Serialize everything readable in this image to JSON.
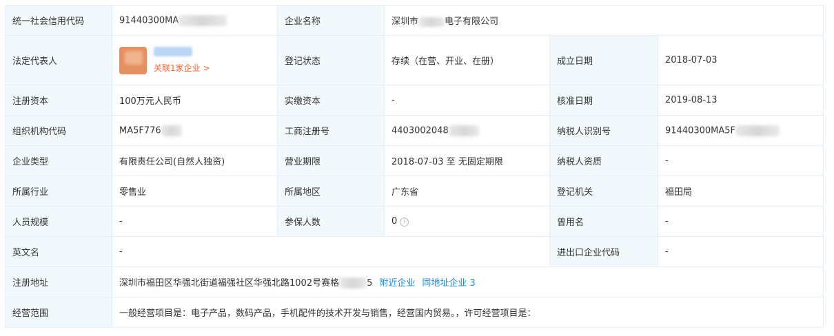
{
  "fields": {
    "credit_code": {
      "label": "统一社会信用代码",
      "value": "91440300MA"
    },
    "company_name": {
      "label": "企业名称",
      "value_pre": "深圳市",
      "value_post": "电子有限公司"
    },
    "legal_rep": {
      "label": "法定代表人",
      "related_link": "关联1家企业 >"
    },
    "reg_status": {
      "label": "登记状态",
      "value": "存续（在营、开业、在册）"
    },
    "found_date": {
      "label": "成立日期",
      "value": "2018-07-03"
    },
    "reg_capital": {
      "label": "注册资本",
      "value": "100万元人民币"
    },
    "paid_capital": {
      "label": "实缴资本",
      "value": "-"
    },
    "approve_date": {
      "label": "核准日期",
      "value": "2019-08-13"
    },
    "org_code": {
      "label": "组织机构代码",
      "value": "MA5F776"
    },
    "biz_reg_no": {
      "label": "工商注册号",
      "value": "4403002048"
    },
    "taxpayer_id": {
      "label": "纳税人识别号",
      "value": "91440300MA5F"
    },
    "company_type": {
      "label": "企业类型",
      "value": "有限责任公司(自然人独资)"
    },
    "biz_term": {
      "label": "营业期限",
      "value": "2018-07-03 至 无固定期限"
    },
    "tax_quality": {
      "label": "纳税人资质",
      "value": "-"
    },
    "industry": {
      "label": "所属行业",
      "value": "零售业"
    },
    "region": {
      "label": "所属地区",
      "value": "广东省"
    },
    "reg_authority": {
      "label": "登记机关",
      "value": "福田局"
    },
    "staff_size": {
      "label": "人员规模",
      "value": "-"
    },
    "insured_count": {
      "label": "参保人数",
      "value": "0"
    },
    "former_name": {
      "label": "曾用名",
      "value": "-"
    },
    "english_name": {
      "label": "英文名",
      "value": "-"
    },
    "ie_code": {
      "label": "进出口企业代码",
      "value": "-"
    },
    "reg_address": {
      "label": "注册地址",
      "value_pre": "深圳市福田区华强北街道福强社区华强北路1002号赛格",
      "value_post": "5",
      "nearby_link": "附近企业",
      "same_address_link": "同地址企业 3"
    },
    "biz_scope": {
      "label": "经营范围",
      "value": "一般经营项目是：电子产品，数码产品，手机配件的技术开发与销售，经营国内贸易。，许可经营项目是："
    }
  },
  "colors": {
    "label_bg": "#f2f9fc",
    "border": "#e4eef6",
    "text": "#333333",
    "link_blue": "#128bed",
    "link_orange": "#ff6633",
    "avatar": "#e6905f"
  },
  "icons": {
    "insured_info": "info-circle-icon"
  }
}
